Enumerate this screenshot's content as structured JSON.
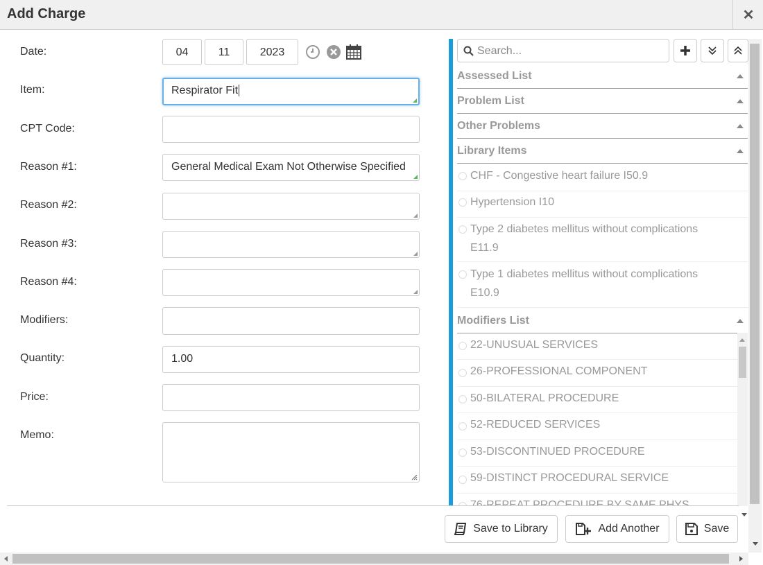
{
  "window": {
    "title": "Add Charge",
    "close_glyph": "✕"
  },
  "form": {
    "date": {
      "label": "Date:",
      "month": "04",
      "day": "11",
      "year": "2023"
    },
    "item": {
      "label": "Item:",
      "value": "Respirator Fit"
    },
    "cpt_code": {
      "label": "CPT Code:",
      "value": ""
    },
    "reason1": {
      "label": "Reason #1:",
      "value": "General Medical Exam Not Otherwise Specified"
    },
    "reason2": {
      "label": "Reason #2:",
      "value": ""
    },
    "reason3": {
      "label": "Reason #3:",
      "value": ""
    },
    "reason4": {
      "label": "Reason #4:",
      "value": ""
    },
    "modifiers": {
      "label": "Modifiers:",
      "value": ""
    },
    "quantity": {
      "label": "Quantity:",
      "value": "1.00"
    },
    "price": {
      "label": "Price:",
      "value": ""
    },
    "memo": {
      "label": "Memo:",
      "value": ""
    }
  },
  "sidebar": {
    "search": {
      "placeholder": "Search..."
    },
    "sections": {
      "assessed": "Assessed List",
      "problem": "Problem List",
      "other": "Other Problems",
      "library": "Library Items",
      "modifiers": "Modifiers List"
    },
    "library_items": [
      {
        "line1": "CHF - Congestive heart failure I50.9",
        "line2": ""
      },
      {
        "line1": "Hypertension I10",
        "line2": ""
      },
      {
        "line1": "Type 2 diabetes mellitus without complications",
        "line2": "E11.9"
      },
      {
        "line1": "Type 1 diabetes mellitus without complications",
        "line2": "E10.9"
      }
    ],
    "modifier_items": [
      "22-UNUSUAL SERVICES",
      "26-PROFESSIONAL COMPONENT",
      "50-BILATERAL PROCEDURE",
      "52-REDUCED SERVICES",
      "53-DISCONTINUED PROCEDURE",
      "59-DISTINCT PROCEDURAL SERVICE",
      "76-REPEAT PROCEDURE BY SAME PHYS"
    ]
  },
  "footer": {
    "save_to_library": "Save to Library",
    "add_another": "Add Another",
    "save": "Save"
  },
  "colors": {
    "accent_bar": "#1b9bd8",
    "focus_border": "#66afe9",
    "muted_text": "#999999"
  }
}
